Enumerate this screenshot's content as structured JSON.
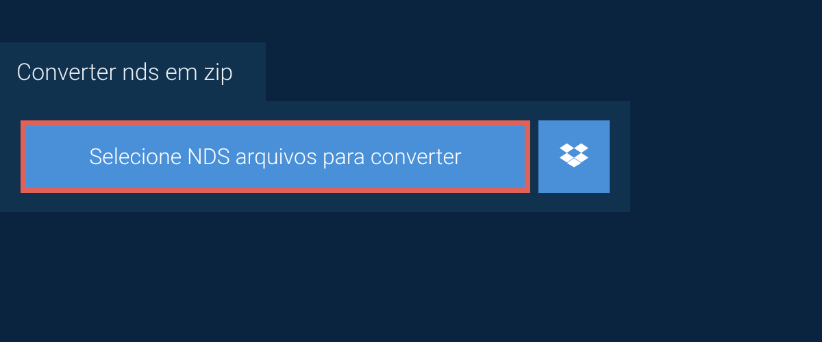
{
  "header": {
    "title": "Converter nds em zip"
  },
  "upload": {
    "select_label": "Selecione NDS arquivos para converter"
  }
}
